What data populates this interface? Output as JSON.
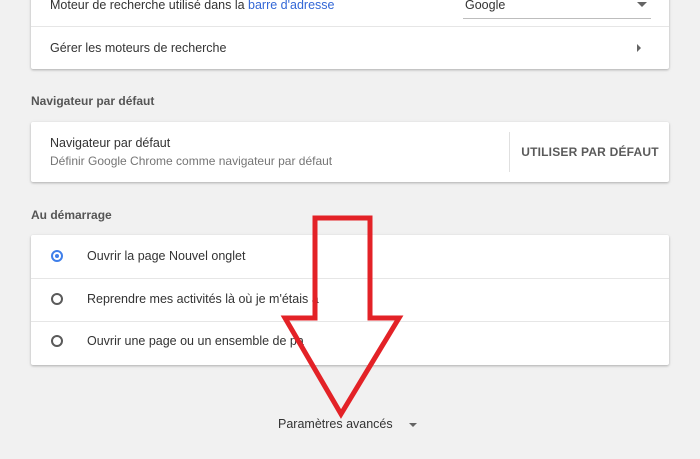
{
  "search": {
    "engine_label_prefix": "Moteur de recherche utilisé dans la ",
    "engine_label_link": "barre d'adresse",
    "engine_value": "Google",
    "manage_label": "Gérer les moteurs de recherche"
  },
  "default_browser": {
    "section_title": "Navigateur par défaut",
    "title": "Navigateur par défaut",
    "description": "Définir Google Chrome comme navigateur par défaut",
    "button": "UTILISER PAR DÉFAUT"
  },
  "startup": {
    "section_title": "Au démarrage",
    "options": [
      {
        "label": "Ouvrir la page Nouvel onglet",
        "selected": true
      },
      {
        "label": "Reprendre mes activités là où je m'étais a",
        "selected": false
      },
      {
        "label": "Ouvrir une page ou un ensemble de pa",
        "selected": false
      }
    ]
  },
  "advanced": {
    "label": "Paramètres avancés"
  },
  "colors": {
    "accent": "#3f7fea",
    "link": "#3367d6",
    "annotation_arrow": "#e32227"
  }
}
